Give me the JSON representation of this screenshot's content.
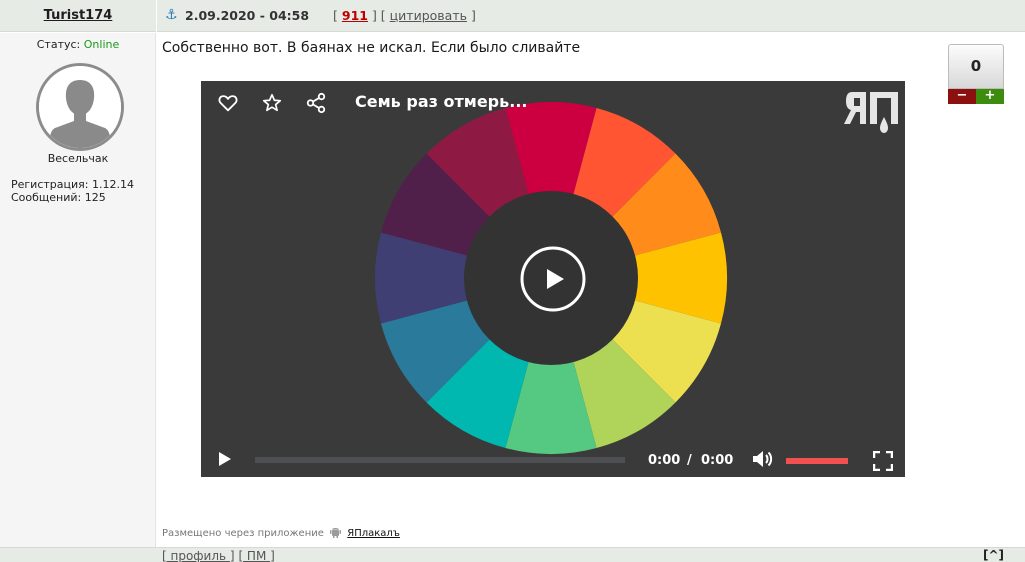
{
  "post": {
    "author": "Turist174",
    "anchor_icon": "anchor-icon",
    "date": "2.09.2020 - 04:58",
    "bracket_open": "[",
    "post_number": "911",
    "bracket_mid": "] [",
    "quote_label": "цитировать",
    "bracket_close": "]",
    "text": "Собственно вот. В баянах не искал. Если было сливайте"
  },
  "user": {
    "status_label": "Статус:",
    "status_value": "Online",
    "rank": "Весельчак",
    "registration_label": "Регистрация:",
    "registration_value": "1.12.14",
    "messages_label": "Сообщений:",
    "messages_value": "125",
    "colors": {
      "online": "#1b9a1b"
    }
  },
  "video": {
    "title": "Семь раз отмерь...",
    "time_current": "0:00",
    "time_separator": "/",
    "time_total": "0:00",
    "progress": 0,
    "volume": 1,
    "icons": [
      "heart-icon",
      "star-icon",
      "share-icon",
      "yap-logo-icon",
      "play-icon",
      "volume-icon",
      "fullscreen-icon"
    ],
    "wheel_colors": [
      "#cc0040",
      "#ff5533",
      "#ff8c1a",
      "#ffc200",
      "#ece050",
      "#b0d45a",
      "#55c882",
      "#00b8b0",
      "#2a7a9c",
      "#3f3f73",
      "#51204a",
      "#8e1a44"
    ],
    "colors": {
      "background": "#3a3a3a",
      "volume": "#f05050"
    }
  },
  "rating": {
    "value": "0",
    "minus": "−",
    "plus": "+"
  },
  "posted_via": {
    "prefix": "Размещено через приложение",
    "app_name": "ЯПлакалъ"
  },
  "footer": {
    "profile": "[ профиль ]",
    "pm": "[ ПМ ]",
    "to_top": "[^]"
  }
}
